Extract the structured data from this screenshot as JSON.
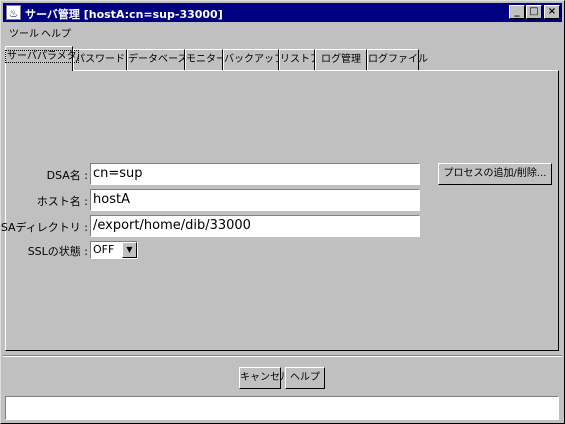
{
  "window": {
    "title": "サーバ管理 [hostA:cn=sup-33000]",
    "minimize": "_",
    "maximize": "□",
    "close": "×"
  },
  "menu": [
    "ツール",
    "ヘルプ"
  ],
  "tabs": [
    "サーバパラメタ",
    "パスワード",
    "データベース",
    "モニター",
    "バックアップ",
    "リストア",
    "ログ管理",
    "ログファイル"
  ],
  "form": {
    "dsa_name_label": "DSA名 :",
    "dsa_name_value": "cn=sup",
    "host_name_label": "ホスト名 :",
    "host_name_value": "hostA",
    "dsa_dir_label": "DSAディレクトリ :",
    "dsa_dir_value": "/export/home/dib/33000",
    "ssl_label": "SSLの状態 :",
    "ssl_value": "OFF"
  },
  "buttons": {
    "process": "プロセスの追加/削除...",
    "cancel": "キャンセル",
    "help": "ヘルプ"
  },
  "status_text": ""
}
